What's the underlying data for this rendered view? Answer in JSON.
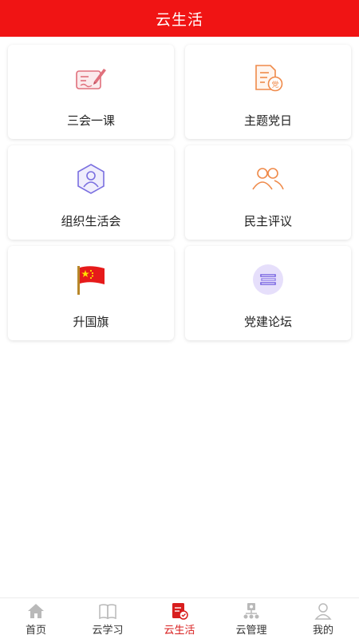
{
  "header": {
    "title": "云生活"
  },
  "cards": [
    {
      "label": "三会一课",
      "icon": "signature-card-icon",
      "color": "#e0707c"
    },
    {
      "label": "主题党日",
      "icon": "party-document-icon",
      "color": "#ef8a4a"
    },
    {
      "label": "组织生活会",
      "icon": "hexagon-person-icon",
      "color": "#7a6fe0"
    },
    {
      "label": "民主评议",
      "icon": "people-icon",
      "color": "#ef8a4a"
    },
    {
      "label": "升国旗",
      "icon": "china-flag-icon",
      "color": "#e61a1a"
    },
    {
      "label": "党建论坛",
      "icon": "book-stack-icon",
      "color": "#8c7ae6"
    }
  ],
  "tabbar": {
    "items": [
      {
        "label": "首页",
        "icon": "home-icon",
        "active": false
      },
      {
        "label": "云学习",
        "icon": "book-icon",
        "active": false
      },
      {
        "label": "云生活",
        "icon": "party-life-icon",
        "active": true
      },
      {
        "label": "云管理",
        "icon": "org-manage-icon",
        "active": false
      },
      {
        "label": "我的",
        "icon": "profile-icon",
        "active": false
      }
    ],
    "active_color": "#d81e1e"
  },
  "colors": {
    "header": "#f01414"
  }
}
